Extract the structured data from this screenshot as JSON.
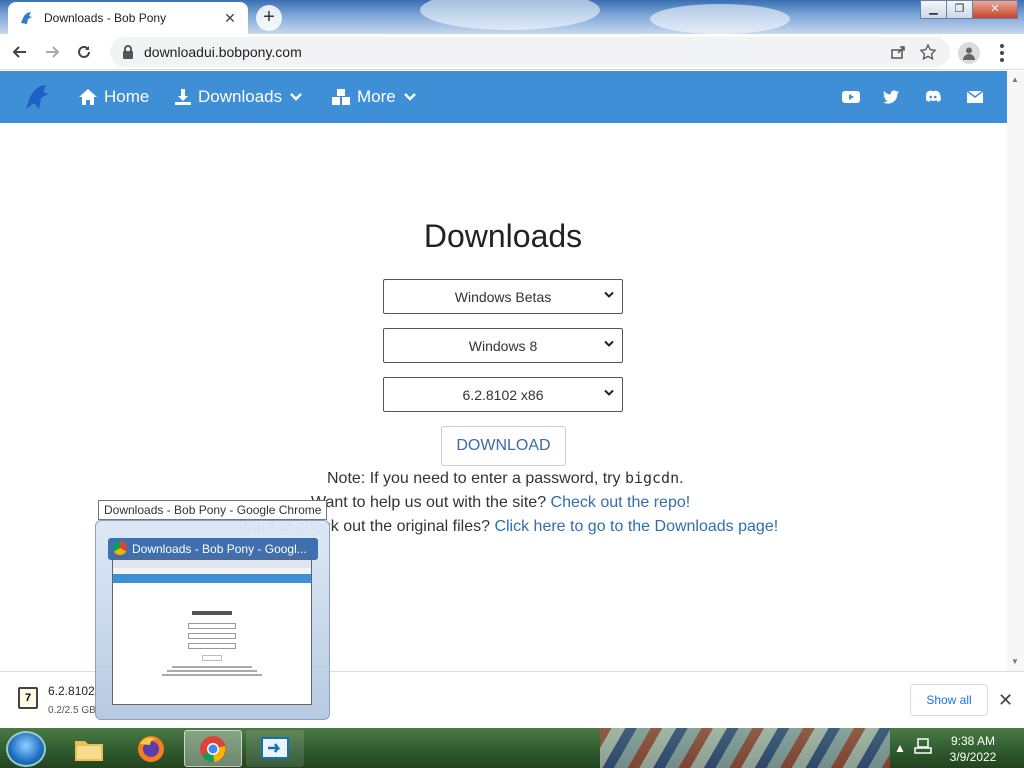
{
  "browser": {
    "tab_title": "Downloads - Bob Pony",
    "url": "downloadui.bobpony.com"
  },
  "nav": {
    "home": "Home",
    "downloads": "Downloads",
    "more": "More"
  },
  "main": {
    "title": "Downloads",
    "select_category": "Windows Betas",
    "select_os": "Windows 8",
    "select_build": "6.2.8102 x86",
    "download_button": "DOWNLOAD",
    "note_prefix": "Note: If you need to enter a password, try ",
    "note_code": "bigcdn",
    "note_suffix": ".",
    "help_prefix": "Want to help us out with the site? ",
    "help_link": "Check out the repo!",
    "originals_prefix": "Want to check out the original files? ",
    "originals_link": "Click here to go to the Downloads page!"
  },
  "taskbar_preview": {
    "tooltip": "Downloads - Bob Pony - Google Chrome",
    "window_title": "Downloads - Bob Pony - Googl..."
  },
  "download_shelf": {
    "file_name": "6.2.8102",
    "status": "0.2/2.5 GB",
    "show_all": "Show all"
  },
  "clock": {
    "time": "9:38 AM",
    "date": "3/9/2022"
  },
  "colors": {
    "header": "#3e8fd6",
    "link": "#2f6fb0"
  }
}
